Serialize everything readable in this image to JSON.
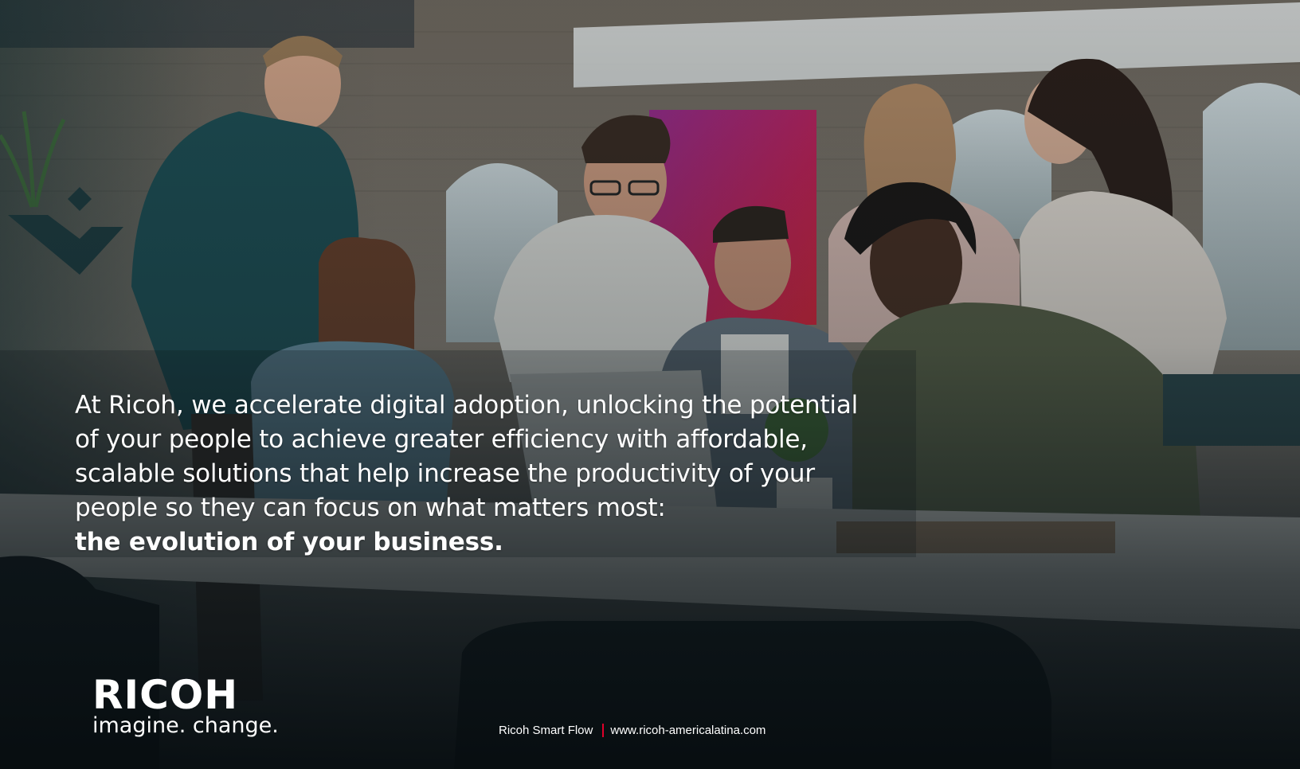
{
  "headline": {
    "line1": "At Ricoh, we accelerate digital adoption, unlocking the potential",
    "line2": "of your people to achieve greater efficiency with affordable,",
    "line3": "scalable solutions that help increase the productivity of your",
    "line4": "people so they can focus on what matters most:",
    "line5": "the evolution of your business."
  },
  "brand": {
    "logo": "RICOH",
    "tagline": "imagine. change."
  },
  "footer": {
    "product": "Ricoh Smart Flow",
    "website": "www.ricoh-americalatina.com"
  },
  "colors": {
    "accent": "#e0002a",
    "text": "#ffffff",
    "overlay": "#0e1a1f"
  }
}
